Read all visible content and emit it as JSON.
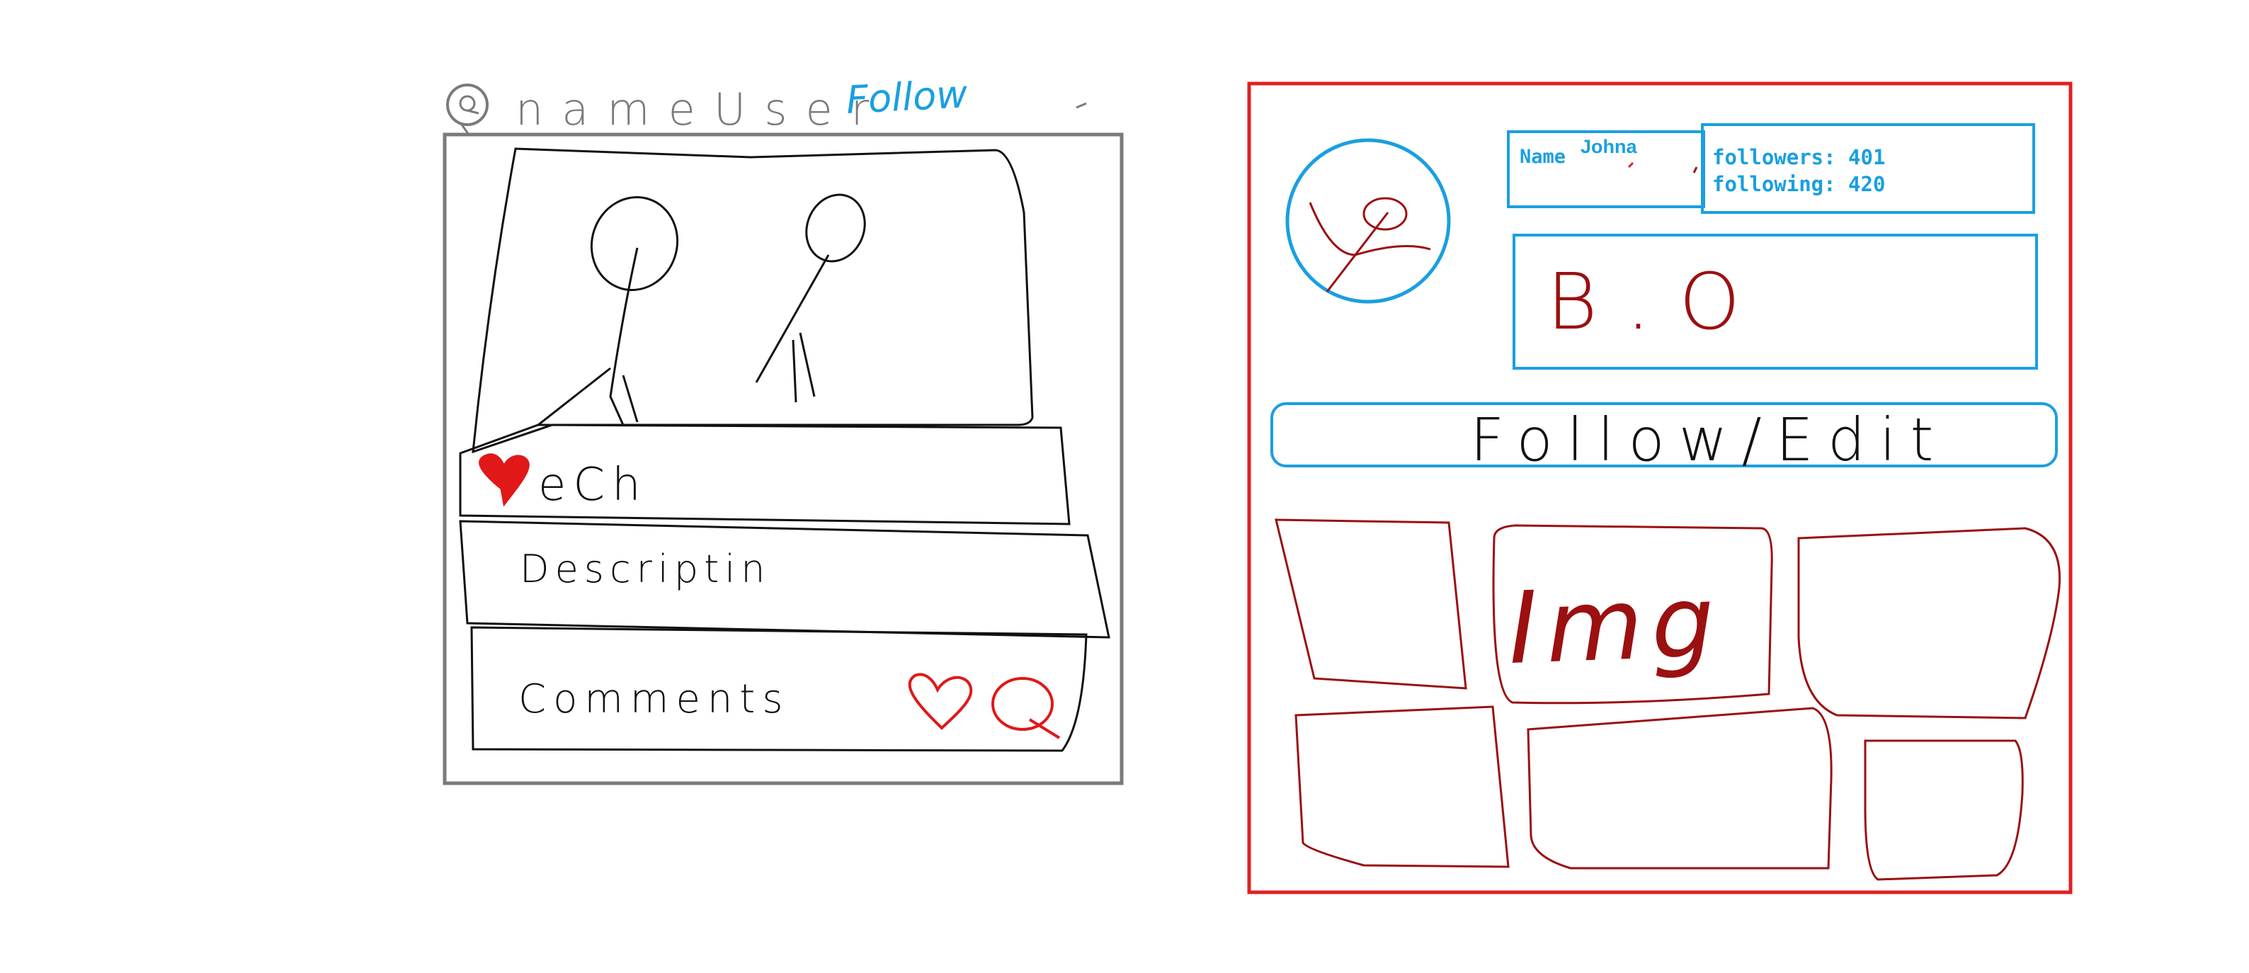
{
  "colors": {
    "ink": "#111111",
    "frame_gray": "#7a7a7a",
    "profile_red": "#e02020",
    "blue": "#1a9fe0",
    "dark_red": "#9b1010",
    "heart_red": "#e01818"
  },
  "post_sketch": {
    "username": "nameUser",
    "follow_link": "Follow",
    "actions": "eCh",
    "description": "Descriptin",
    "comments": "Comments"
  },
  "profile_sketch": {
    "name_label": "Name",
    "name_value": "Johna",
    "followers": "followers: 401",
    "following": "following: 420",
    "bio": "B.O",
    "follow_edit_button": "Follow/Edit",
    "grid_label": "Img"
  }
}
